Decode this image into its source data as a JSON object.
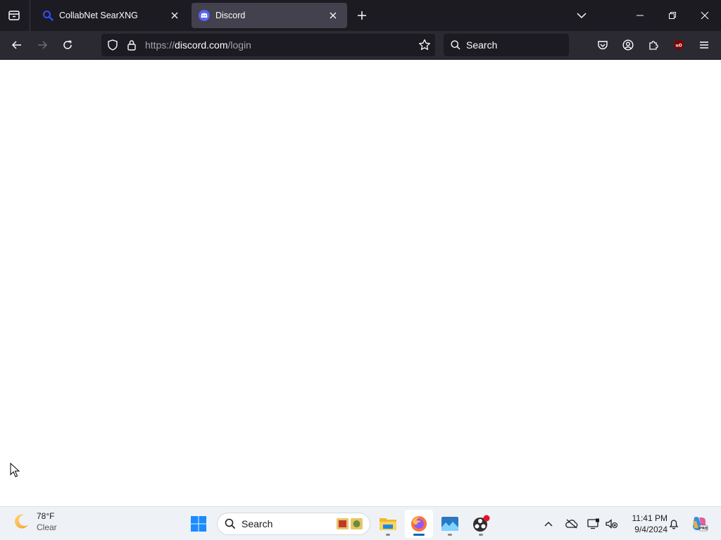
{
  "browser": {
    "tabs": [
      {
        "title": "CollabNet SearXNG",
        "favicon": "search-magnifier-icon",
        "selected": false
      },
      {
        "title": "Discord",
        "favicon": "discord-icon",
        "selected": true
      }
    ],
    "url": {
      "scheme": "https://",
      "host": "discord.com",
      "path": "/login"
    },
    "search_placeholder": "Search",
    "colors": {
      "tabstrip": "#1c1b22",
      "toolbar": "#2b2a33",
      "selected_tab": "#42414d",
      "discord": "#5865f2"
    }
  },
  "taskbar": {
    "weather": {
      "temp": "78°F",
      "condition": "Clear",
      "icon": "moon-icon"
    },
    "search_placeholder": "Search",
    "clock": {
      "time": "11:41 PM",
      "date": "9/4/2024"
    },
    "apps": [
      "start-icon",
      "file-explorer-icon",
      "firefox-icon",
      "photos-icon",
      "obs-icon"
    ]
  }
}
